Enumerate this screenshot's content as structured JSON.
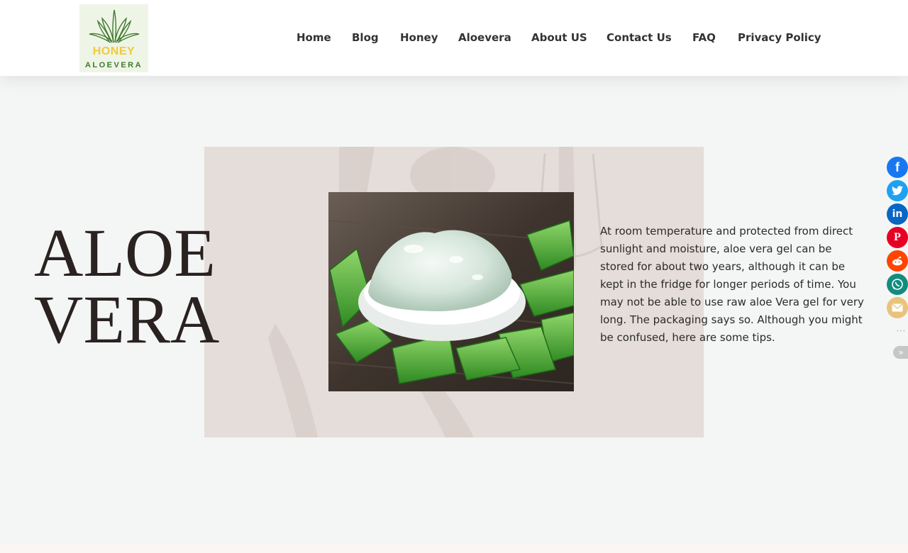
{
  "header": {
    "logo": {
      "line1": "HONEY",
      "line2": "ALOEVERA"
    },
    "nav": [
      {
        "label": "Home"
      },
      {
        "label": "Blog"
      },
      {
        "label": "Honey"
      },
      {
        "label": "Aloevera"
      },
      {
        "label": "About US"
      },
      {
        "label": "Contact Us"
      },
      {
        "label": "FAQ"
      },
      {
        "label": "Privacy Policy"
      }
    ]
  },
  "hero": {
    "title_line1": "ALOE",
    "title_line2": "VERA",
    "description": " At room temperature and protected from direct sunlight and moisture, aloe vera gel can be stored for about two years, although it can be kept in the fridge for longer periods of time. You may not be able to use raw aloe Vera gel for very long. The packaging says so. Although you might be confused, here are some tips."
  },
  "share_bar": {
    "buttons": [
      {
        "icon": "facebook-icon",
        "color": "#1877f2"
      },
      {
        "icon": "twitter-icon",
        "color": "#1da1f2"
      },
      {
        "icon": "linkedin-icon",
        "color": "#0a66c2"
      },
      {
        "icon": "pinterest-icon",
        "color": "#e60023"
      },
      {
        "icon": "reddit-icon",
        "color": "#ff4500"
      },
      {
        "icon": "whatsapp-icon",
        "color": "#128c7e"
      },
      {
        "icon": "email-icon",
        "color": "#e8c47a"
      }
    ],
    "more_icon": "more-dots-icon",
    "collapse_icon": "double-chevron-right-icon"
  },
  "colors": {
    "background": "#f4f6f5",
    "hero_panel": "#e5ddd9",
    "title_text": "#2a2220",
    "nav_text": "#333333"
  }
}
